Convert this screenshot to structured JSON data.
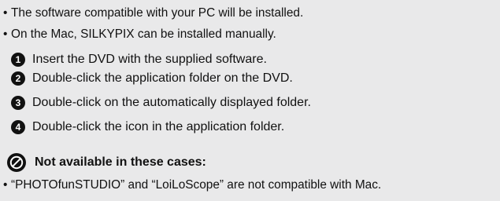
{
  "bullets_top": [
    "The software compatible with your PC will be installed.",
    "On the Mac, SILKYPIX can be installed manually."
  ],
  "bullet_symbol": "•",
  "steps": [
    {
      "num": "1",
      "text": "Insert the DVD with the supplied software."
    },
    {
      "num": "2",
      "text": "Double-click the application folder on the DVD."
    },
    {
      "num": "3",
      "text": "Double-click on the automatically displayed folder."
    },
    {
      "num": "4",
      "text": "Double-click the icon in the application folder."
    }
  ],
  "note": {
    "icon": "not-available-icon",
    "heading": "Not available in these cases:",
    "items": [
      "“PHOTOfunSTUDIO” and “LoiLoScope” are not compatible with Mac."
    ]
  },
  "colors": {
    "background": "#e9e9ea",
    "text": "#111111",
    "step_badge": "#111111"
  }
}
